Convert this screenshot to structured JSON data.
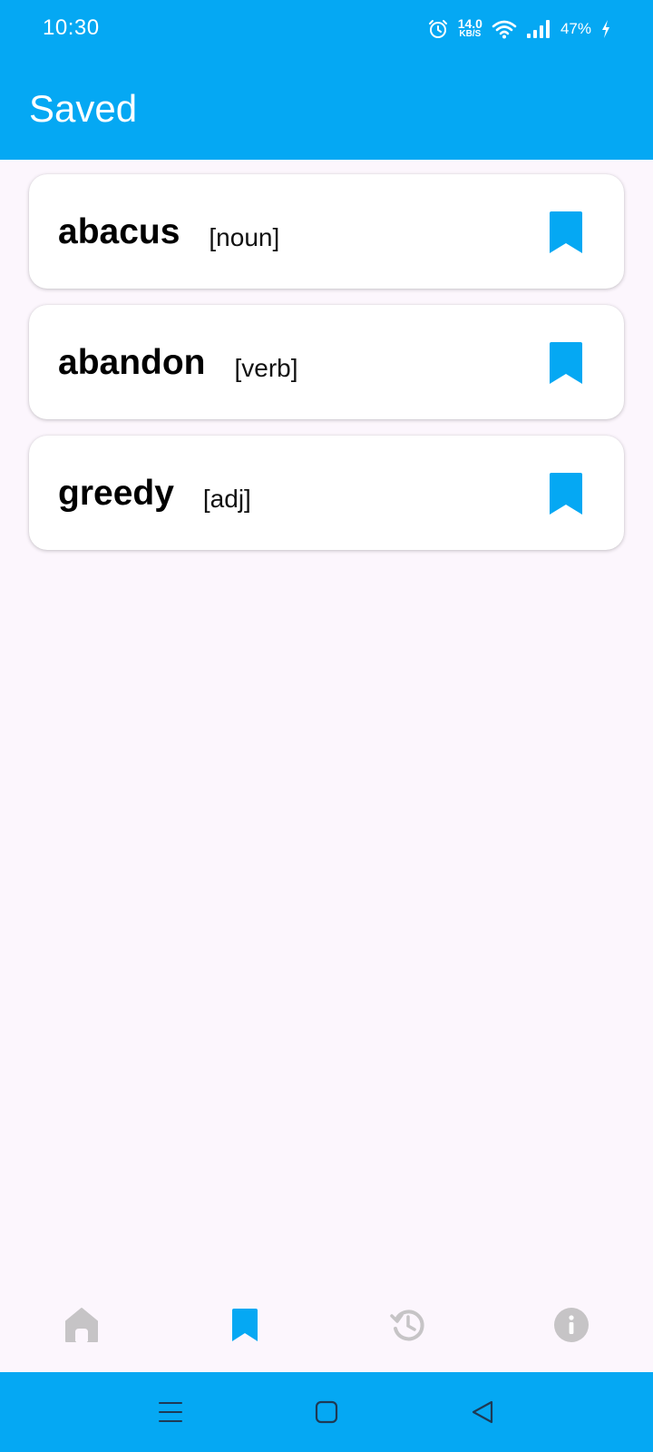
{
  "status_bar": {
    "time": "10:30",
    "net_speed_value": "14.0",
    "net_speed_unit": "KB/S",
    "battery": "47%",
    "icons": [
      "alarm-icon",
      "wifi-icon",
      "signal-icon",
      "charging-icon"
    ]
  },
  "app_bar": {
    "title": "Saved"
  },
  "saved_words": [
    {
      "word": "abacus",
      "part_of_speech": "[noun]"
    },
    {
      "word": "abandon",
      "part_of_speech": "[verb]"
    },
    {
      "word": "greedy",
      "part_of_speech": "[adj]"
    }
  ],
  "bottom_nav": {
    "items": [
      {
        "icon": "home-icon",
        "active": false
      },
      {
        "icon": "bookmark-icon",
        "active": true
      },
      {
        "icon": "history-icon",
        "active": false
      },
      {
        "icon": "info-icon",
        "active": false
      }
    ]
  },
  "system_nav": {
    "icons": [
      "menu-icon",
      "home-square-icon",
      "back-triangle-icon"
    ]
  },
  "colors": {
    "primary": "#05a8f3",
    "background": "#fcf6fd",
    "inactive_icon": "#c6c4c6"
  }
}
